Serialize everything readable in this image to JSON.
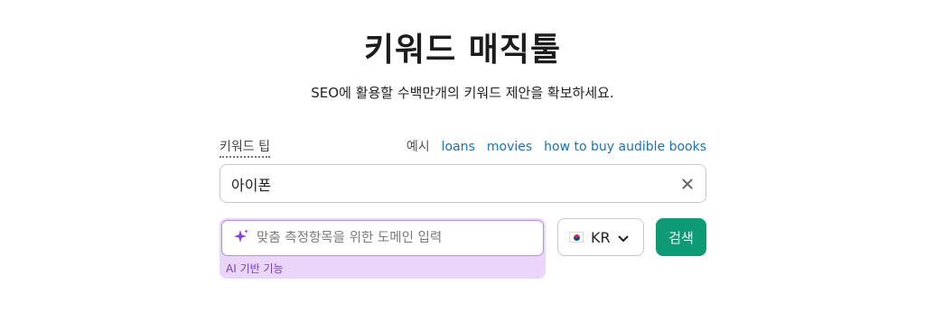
{
  "page": {
    "title": "키워드 매직툴",
    "subtitle": "SEO에 활용할 수백만개의 키워드 제안을 확보하세요."
  },
  "tips": {
    "label": "키워드 팁"
  },
  "examples": {
    "label": "예시",
    "links": [
      "loans",
      "movies",
      "how to buy audible books"
    ]
  },
  "keyword_input": {
    "value": "아이폰"
  },
  "domain_input": {
    "placeholder": "맞춤 측정항목을 위한 도메인 입력",
    "ai_caption": "AI 기반 기능"
  },
  "country_select": {
    "flag_icon": "kr-flag-icon",
    "code": "KR"
  },
  "search_button": {
    "label": "검색",
    "color": "#0d9a74"
  },
  "colors": {
    "link": "#1a73b8",
    "ai_accent": "#ead6fb"
  }
}
